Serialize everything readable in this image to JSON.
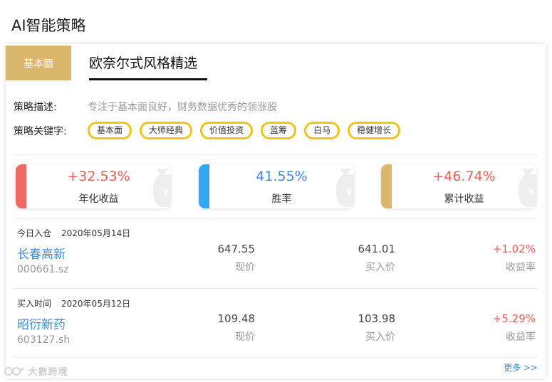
{
  "page": {
    "title": "AI智能策略"
  },
  "tabs": {
    "active": "基本面"
  },
  "strategy": {
    "name": "欧奈尔式风格精选",
    "desc_label": "策略描述:",
    "desc": "专注于基本面良好，财务数据优秀的领涨股",
    "kw_label": "策略关键字:",
    "keywords": [
      "基本面",
      "大师经典",
      "价值投资",
      "蓝筹",
      "白马",
      "稳健增长"
    ]
  },
  "stats": [
    {
      "value": "+32.53%",
      "label": "年化收益",
      "color": "#e95e55",
      "bar": "#f06a64"
    },
    {
      "value": "41.55%",
      "label": "胜率",
      "color": "#3c8cd8",
      "bar": "#34a8f6"
    },
    {
      "value": "+46.74%",
      "label": "累计收益",
      "color": "#e95e55",
      "bar": "#dbb66f"
    }
  ],
  "stocks": [
    {
      "head_label": "今日入仓",
      "head_date": "2020年05月14日",
      "name": "长春高新",
      "code": "000661.sz",
      "price": "647.55",
      "price_label": "现价",
      "buy": "641.01",
      "buy_label": "买入价",
      "rate": "+1.02%",
      "rate_label": "收益率"
    },
    {
      "head_label": "买入时间",
      "head_date": "2020年05月12日",
      "name": "昭衍新药",
      "code": "603127.sh",
      "price": "109.48",
      "price_label": "现价",
      "buy": "103.98",
      "buy_label": "买入价",
      "rate": "+5.29%",
      "rate_label": "收益率"
    }
  ],
  "more": "更多 >>",
  "watermark": "大數跨境"
}
